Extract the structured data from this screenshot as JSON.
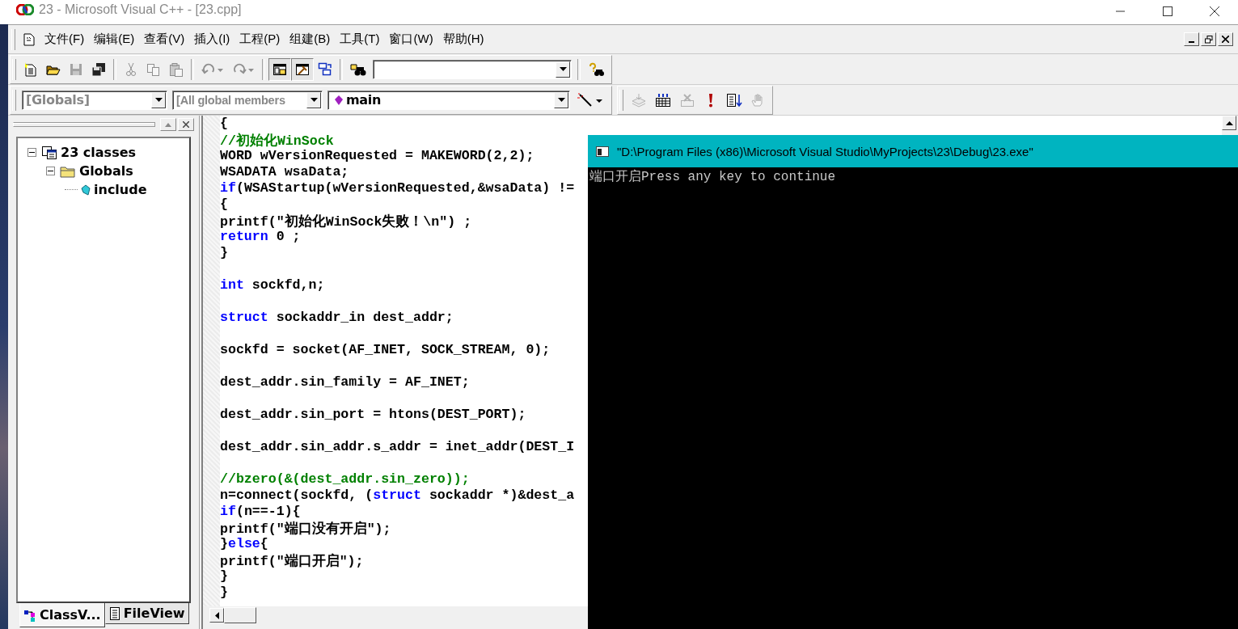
{
  "window": {
    "title": "23 - Microsoft Visual C++ - [23.cpp]"
  },
  "menu": [
    "文件(F)",
    "编辑(E)",
    "查看(V)",
    "插入(I)",
    "工程(P)",
    "组建(B)",
    "工具(T)",
    "窗口(W)",
    "帮助(H)"
  ],
  "standard_toolbar": {
    "buttons": [
      {
        "disabled": false,
        "pressed": false
      },
      {
        "disabled": false,
        "pressed": false
      },
      {
        "disabled": true,
        "pressed": false
      },
      {
        "disabled": false,
        "pressed": false
      },
      {
        "disabled": true,
        "pressed": false
      },
      {
        "disabled": true,
        "pressed": false
      },
      {
        "disabled": true,
        "pressed": false
      },
      {
        "disabled": true,
        "pressed": false
      },
      {
        "disabled": true,
        "pressed": false
      },
      {
        "disabled": false,
        "pressed": true
      },
      {
        "disabled": false,
        "pressed": true
      },
      {
        "disabled": false,
        "pressed": false
      },
      {
        "disabled": false,
        "pressed": false
      },
      {
        "disabled": false,
        "pressed": false
      }
    ]
  },
  "wizard_bar": {
    "class_combo": "[Globals]",
    "filter_combo": "[All global members",
    "function_combo": "main"
  },
  "build_toolbar": {
    "buttons": [
      {
        "disabled": true
      },
      {
        "disabled": false
      },
      {
        "disabled": true
      },
      {
        "disabled": false
      },
      {
        "disabled": false
      },
      {
        "disabled": true
      }
    ]
  },
  "workspace": {
    "tree": [
      {
        "label": "23 classes",
        "kind": "project",
        "expanded": true,
        "children": [
          {
            "label": "Globals",
            "kind": "folder",
            "expanded": true,
            "children": [
              {
                "label": "include",
                "kind": "member"
              }
            ]
          }
        ]
      }
    ],
    "tabs": [
      {
        "label": "ClassV...",
        "selected": true
      },
      {
        "label": "FileView",
        "selected": false
      }
    ]
  },
  "editor": {
    "lines": [
      {
        "kind": "code",
        "tokens": [
          {
            "kind": "plain",
            "text": "{"
          }
        ]
      },
      {
        "kind": "code",
        "tokens": [
          {
            "kind": "comment",
            "text": "//初始化WinSock"
          }
        ]
      },
      {
        "kind": "code",
        "tokens": [
          {
            "kind": "plain",
            "text": "WORD wVersionRequested = MAKEWORD(2,2);"
          }
        ]
      },
      {
        "kind": "code",
        "tokens": [
          {
            "kind": "plain",
            "text": "WSADATA wsaData;"
          }
        ]
      },
      {
        "kind": "code",
        "tokens": [
          {
            "kind": "keyword",
            "text": "if"
          },
          {
            "kind": "plain",
            "text": "(WSAStartup(wVersionRequested,&wsaData) !="
          }
        ]
      },
      {
        "kind": "code",
        "tokens": [
          {
            "kind": "plain",
            "text": "{"
          }
        ]
      },
      {
        "kind": "code",
        "tokens": [
          {
            "kind": "plain",
            "text": "printf(\"初始化WinSock失败！\\n\") ;"
          }
        ]
      },
      {
        "kind": "code",
        "tokens": [
          {
            "kind": "keyword",
            "text": "return"
          },
          {
            "kind": "plain",
            "text": " 0 ;"
          }
        ]
      },
      {
        "kind": "code",
        "tokens": [
          {
            "kind": "plain",
            "text": "}"
          }
        ]
      },
      {
        "kind": "blank"
      },
      {
        "kind": "code",
        "tokens": [
          {
            "kind": "keyword",
            "text": "int"
          },
          {
            "kind": "plain",
            "text": " sockfd,n;"
          }
        ]
      },
      {
        "kind": "blank"
      },
      {
        "kind": "code",
        "tokens": [
          {
            "kind": "keyword",
            "text": "struct"
          },
          {
            "kind": "plain",
            "text": " sockaddr_in dest_addr;"
          }
        ]
      },
      {
        "kind": "blank"
      },
      {
        "kind": "code",
        "tokens": [
          {
            "kind": "plain",
            "text": "sockfd = socket(AF_INET, SOCK_STREAM, 0);"
          }
        ]
      },
      {
        "kind": "blank"
      },
      {
        "kind": "code",
        "tokens": [
          {
            "kind": "plain",
            "text": "dest_addr.sin_family = AF_INET;"
          }
        ]
      },
      {
        "kind": "blank"
      },
      {
        "kind": "code",
        "tokens": [
          {
            "kind": "plain",
            "text": "dest_addr.sin_port = htons(DEST_PORT);"
          }
        ]
      },
      {
        "kind": "blank"
      },
      {
        "kind": "code",
        "tokens": [
          {
            "kind": "plain",
            "text": "dest_addr.sin_addr.s_addr = inet_addr(DEST_I"
          }
        ]
      },
      {
        "kind": "blank"
      },
      {
        "kind": "code",
        "tokens": [
          {
            "kind": "comment",
            "text": "//bzero(&(dest_addr.sin_zero));"
          }
        ]
      },
      {
        "kind": "code",
        "tokens": [
          {
            "kind": "plain",
            "text": "n=connect(sockfd, ("
          },
          {
            "kind": "keyword",
            "text": "struct"
          },
          {
            "kind": "plain",
            "text": " sockaddr *)&dest_a"
          }
        ]
      },
      {
        "kind": "code",
        "tokens": [
          {
            "kind": "keyword",
            "text": "if"
          },
          {
            "kind": "plain",
            "text": "(n==-1){"
          }
        ]
      },
      {
        "kind": "code",
        "tokens": [
          {
            "kind": "plain",
            "text": "printf(\"端口没有开启\");"
          }
        ]
      },
      {
        "kind": "code",
        "tokens": [
          {
            "kind": "plain",
            "text": "}"
          },
          {
            "kind": "keyword",
            "text": "else"
          },
          {
            "kind": "plain",
            "text": "{"
          }
        ]
      },
      {
        "kind": "code",
        "tokens": [
          {
            "kind": "plain",
            "text": "printf(\"端口开启\");"
          }
        ]
      },
      {
        "kind": "code",
        "tokens": [
          {
            "kind": "plain",
            "text": "}"
          }
        ]
      },
      {
        "kind": "code",
        "tokens": [
          {
            "kind": "plain",
            "text": "}"
          }
        ]
      }
    ]
  },
  "console": {
    "title": "\"D:\\Program Files (x86)\\Microsoft Visual Studio\\MyProjects\\23\\Debug\\23.exe\"",
    "output": "端口开启Press any key to continue"
  }
}
